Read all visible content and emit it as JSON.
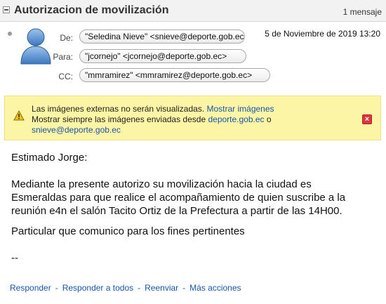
{
  "header": {
    "subject": "Autorizacion de movilización",
    "message_count": "1 mensaje"
  },
  "message": {
    "from_label": "De:",
    "from": "\"Seledina Nieve\" <snieve@deporte.gob.ec>",
    "to_label": "Para:",
    "to": "\"jcornejo\" <jcornejo@deporte.gob.ec>",
    "cc_label": "CC:",
    "cc": "\"mmramirez\" <mmramirez@deporte.gob.ec>",
    "date": "5 de Noviembre de 2019 13:20"
  },
  "warning": {
    "line1_text": "Las imágenes externas no serán visualizadas.",
    "line1_link": "Mostrar imágenes",
    "line2_text": "Mostrar siempre las imágenes enviadas desde",
    "line2_link": "deporte.gob.ec",
    "line2_suffix": "o",
    "line3_link": "snieve@deporte.gob.ec"
  },
  "body": {
    "greeting": "Estimado Jorge:",
    "para1_line1": "Mediante la presente autorizo su movilización hacia la ciudad es",
    "para1_line2": "Esmeraldas para que realice el acompañamiento de quien suscribe a la",
    "para1_line3": "reunión e4n el salón Tacito Ortiz de la Prefectura a partir de las 14H00.",
    "para2": "Particular que comunico para los fines pertinentes",
    "signature": "--"
  },
  "actions": {
    "reply": "Responder",
    "reply_all": "Responder a todos",
    "forward": "Reenviar",
    "more": "Más acciones",
    "separator": "-"
  },
  "colors": {
    "link": "#1a56a8",
    "warning_bg": "#fbf5a5",
    "close_button": "#d9363e"
  }
}
